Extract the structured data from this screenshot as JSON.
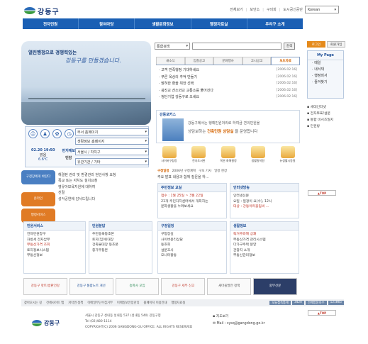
{
  "header": {
    "logo_text": "강동구",
    "top_links": [
      "전체보기",
      "보안소",
      "구의회",
      "도시공신공단"
    ],
    "language": "Korean",
    "gnb": [
      "전자민원",
      "참여마당",
      "생활문화정보",
      "행정자료실",
      "우리구 소개"
    ]
  },
  "visual": {
    "slogan1": "열린행정으로 경쟁력있는",
    "slogan2": "강동구를 만들겠습니다."
  },
  "quick": {
    "selects": [
      "부서 홈페이지",
      "생활정보 홈페이지",
      "서울시 / 자치구",
      "유관기관 / 기타"
    ],
    "date": "02.20 19:50",
    "weather_label": "맑음",
    "temp": "6.6℃",
    "pollution_label": "먼지예보",
    "pollution_value": "민감"
  },
  "left_banners": [
    "구청장에게 바란다",
    "온라인",
    "행정서비스"
  ],
  "left_list": [
    "해결된 관리 및 환경관리 현안사항 요청",
    "폭교 또는 자치도 설치요청",
    "",
    "",
    "영유아보육지원에 대하여",
    "친절",
    "성악공연에 감사드립니다"
  ],
  "search": {
    "scope": "통합검색",
    "placeholder": "",
    "button": "검색"
  },
  "news": {
    "tabs": [
      "새소식",
      "입찰공고",
      "문화행사",
      "고시공고",
      "보도자료"
    ],
    "active_tab": 4,
    "items": [
      {
        "title": "고객 만족행정 기대하세요",
        "date": "[2006.02.16]"
      },
      {
        "title": "푸른 옥상의 추억 만들기",
        "date": "[2006.02.16]"
      },
      {
        "title": "밝혀한 환을 위한 선택",
        "date": "[2006.02.16]"
      },
      {
        "title": "광진교 산소와교 교통소를 풀어진다",
        "date": "[2006.02.16]"
      },
      {
        "title": "청단기업 강동구로 오세요",
        "date": "[2006.02.16]"
      }
    ]
  },
  "focus": {
    "title": "강동포커스",
    "line1": "강동구에서는 행예민원처리로 하여금 견의민원을",
    "line2_pre": "상담보하는",
    "line2_hl": "건축민원 상담실",
    "line2_post": "을 운영합니다"
  },
  "services": [
    "사이버구청장",
    "전자도서관",
    "복권 화해결정",
    "생활밀착원",
    "뉴생활시동절"
  ],
  "subtabs": [
    "구정일정",
    "2006년 구정계획",
    "구보 기사",
    "일정 현장"
  ],
  "subnews": [
    "주요 발표 내용과 함께 질문을 하...",
    "",
    "",
    "",
    ""
  ],
  "cards": {
    "civil": {
      "title": "민원서비스",
      "items": [
        "전자민원창구",
        "자방세 전자납부",
        "부동산가격 조회",
        "토지정보시스템",
        "부동산정보"
      ]
    },
    "permit": {
      "title": "민원분답",
      "items": [
        "주민등록등초본",
        "토지(임야)대장",
        "건축물대장 등초본",
        "증가부등본"
      ]
    },
    "admin": {
      "title": "구정일정",
      "items": [
        "구청장실",
        "사이버윤리상담",
        "동호회",
        "설문조사",
        "모니터활동"
      ]
    },
    "life": {
      "title": "생활정보",
      "items": [
        "독거주와해 상쾌",
        "부동산가격 관리시스템",
        "다가구주택 분양",
        "관광지 소개",
        "부동산감리정보"
      ]
    },
    "edu": {
      "title": "주민정보 교실",
      "items": [
        "접수 : 1월 25일 ~ 3월 22일",
        "21개 주민자치센터에서 개최하는",
        "문화생활을 누려보세요"
      ]
    },
    "seniors": {
      "title": "인터넷방송",
      "items": [
        "인터넷신문",
        "요일 : 일정이 요(수), 12시",
        "대상 : 강동아리올림씨 ..."
      ]
    }
  },
  "right": {
    "tabs": [
      "로그인",
      "회원가입"
    ],
    "mypage_title": "My Page",
    "mypage_items": [
      "메일",
      "내서재",
      "행정비서",
      "즐겨찾기"
    ],
    "links": [
      "세대인터넷",
      "전자투표/설문",
      "통합 비시즈일지",
      "민원방"
    ],
    "top": "TOP"
  },
  "banners": [
    "강동구 핫트/방판건강",
    "강동구 통합노트 개선",
    "송파사 모임",
    "강동구 세무 신고",
    "새마을발전 정책",
    "중부신문"
  ],
  "footer": {
    "links": [
      "찾아오시는 길",
      "전체사이트 맵",
      "저작권 정책",
      "이메일무단수집거부",
      "이메일보안망관리",
      "홈페이지 이용안내",
      "행정자료실"
    ],
    "counters": [
      "오늘접속통계",
      "3420",
      "전체방문자수",
      "121865"
    ],
    "logo_text": "강동구",
    "address": "서울시 강동구 성내동 성내동 537 (성내동 540) 강동구청",
    "tel": "Tel (02)480-1114",
    "copyright": "COPYRIGHT(C) 2006 GANGDONG-GU OFFICE. ALL RIGHTS RESERVED",
    "map_label": "지도보기",
    "email": "Mail : sysq@gangdong.go.kr"
  }
}
